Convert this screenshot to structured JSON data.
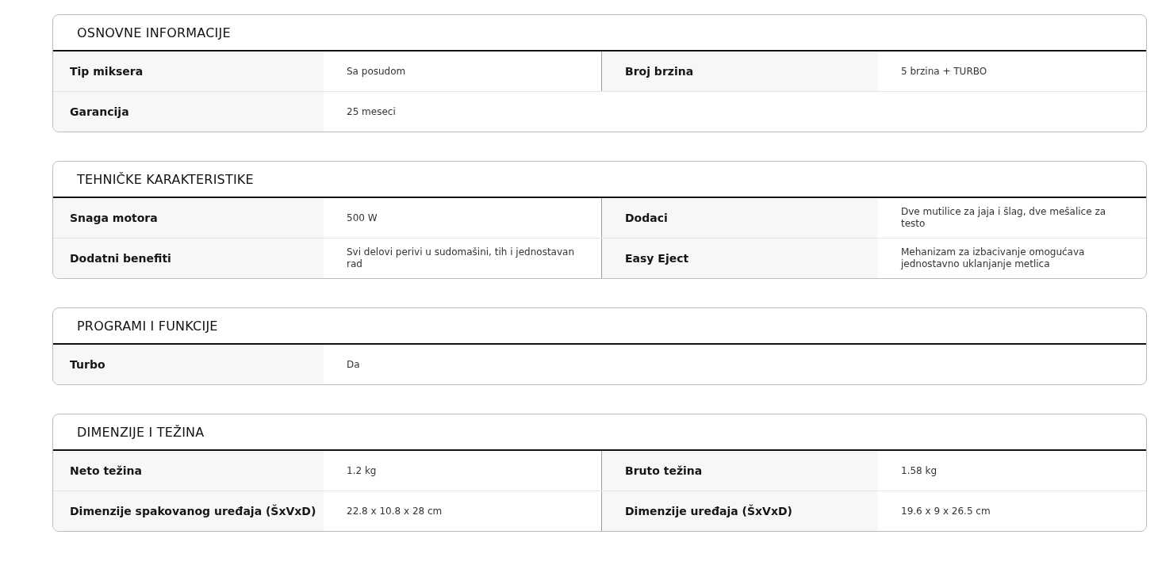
{
  "sections": [
    {
      "title": "OSNOVNE INFORMACIJE",
      "rows": [
        [
          {
            "label": "Tip miksera",
            "value": "Sa posudom"
          },
          {
            "label": "Broj brzina",
            "value": "5 brzina + TURBO"
          }
        ],
        [
          {
            "label": "Garancija",
            "value": "25 meseci"
          }
        ]
      ]
    },
    {
      "title": "TEHNIČKE KARAKTERISTIKE",
      "rows": [
        [
          {
            "label": "Snaga motora",
            "value": "500 W"
          },
          {
            "label": "Dodaci",
            "value": "Dve mutilice za jaja i šlag, dve mešalice za testo"
          }
        ],
        [
          {
            "label": "Dodatni benefiti",
            "value": "Svi delovi perivi u sudomašini, tih i jednostavan rad"
          },
          {
            "label": "Easy Eject",
            "value": "Mehanizam za izbacivanje omogućava jednostavno uklanjanje metlica"
          }
        ]
      ]
    },
    {
      "title": "PROGRAMI I FUNKCIJE",
      "rows": [
        [
          {
            "label": "Turbo",
            "value": "Da"
          }
        ]
      ]
    },
    {
      "title": "DIMENZIJE I TEŽINA",
      "rows": [
        [
          {
            "label": "Neto težina",
            "value": "1.2 kg"
          },
          {
            "label": "Bruto težina",
            "value": "1.58 kg"
          }
        ],
        [
          {
            "label": "Dimenzije spakovanog uređaja (ŠxVxD)",
            "value": "22.8 x 10.8 x 28 cm"
          },
          {
            "label": "Dimenzije uređaja (ŠxVxD)",
            "value": "19.6 x 9 x 26.5 cm"
          }
        ]
      ]
    }
  ]
}
